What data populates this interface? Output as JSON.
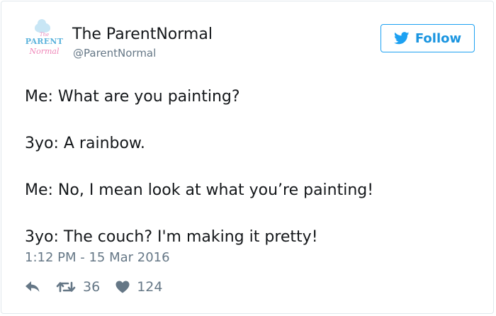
{
  "tweet": {
    "author": {
      "name": "The ParentNormal",
      "handle": "@ParentNormal",
      "logo_text": {
        "top": "The",
        "line1": "PARENT",
        "line2": "Normal"
      }
    },
    "follow_label": "Follow",
    "lines": [
      "Me: What are you painting?",
      "3yo: A rainbow.",
      "Me: No, I mean look at what you’re painting!",
      "3yo: The couch? I'm making it pretty!"
    ],
    "timestamp": "1:12 PM - 15 Mar 2016",
    "actions": {
      "reply_icon": "reply-icon",
      "retweet_icon": "retweet-icon",
      "retweet_count": "36",
      "like_icon": "heart-icon",
      "like_count": "124"
    }
  },
  "colors": {
    "accent": "#1da1f2",
    "secondary_text": "#657786",
    "primary_text": "#14171a",
    "border": "#e1e8ed"
  }
}
